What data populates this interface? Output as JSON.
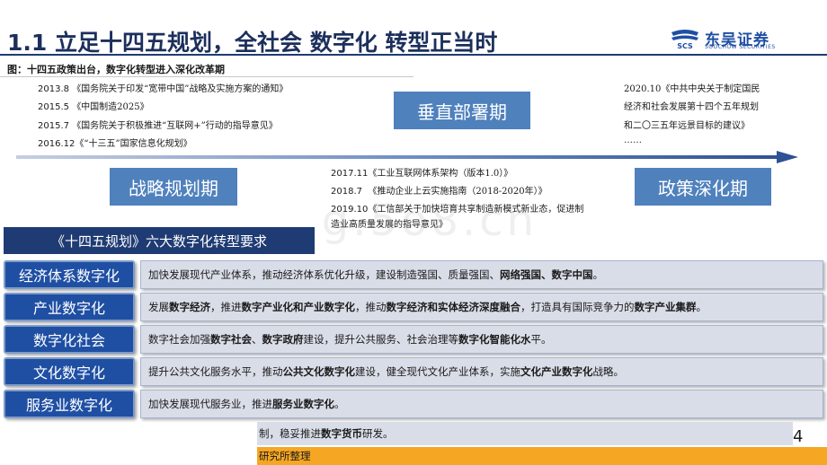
{
  "header": {
    "title": "1.1 立足十四五规划，全社会  数字化  转型正当时",
    "logo_cn": "东吴证券",
    "logo_en": "SOOCHOW SECURITIES",
    "logo_mark": "SCS"
  },
  "figure_caption": "图：十四五政策出台，数字化转型进入深化改革期",
  "timeline": {
    "upper_left": [
      {
        "year": "2013.8",
        "text": "《国务院关于印发“宽带中国”战略及实施方案的通知》"
      },
      {
        "year": "2015.5",
        "text": "《中国制造2025》"
      },
      {
        "year": "2015.7",
        "text": "《国务院关于积极推进“互联网+”行动的指导意见》"
      },
      {
        "year": "2016.12",
        "text": "《“十三五”国家信息化规划》"
      }
    ],
    "upper_right": [
      {
        "line": "2020.10《中共中央关于制定国民"
      },
      {
        "line": "经济和社会发展第十四个五年规划"
      },
      {
        "line": "和二〇三五年远景目标的建议》"
      },
      {
        "line": "……"
      }
    ],
    "lower_middle": [
      {
        "year": "2017.11",
        "text": "《工业互联网体系架构（版本1.0）》"
      },
      {
        "year": "2018.7",
        "text": "《推动企业上云实施指南（2018-2020年）》"
      },
      {
        "year": "2019.10",
        "text": "《工信部关于加快培育共享制造新模式新业态，促进制"
      },
      {
        "year": "",
        "text": "造业高质量发展的指导意见》"
      }
    ],
    "stages": {
      "vertical": "垂直部署期",
      "strategy": "战略规划期",
      "deepening": "政策深化期"
    }
  },
  "requirements": {
    "title": "《十四五规划》六大数字化转型要求",
    "rows": [
      {
        "label": "经济体系数字化",
        "segments": [
          {
            "t": "加快发展现代产业体系，推动经济体系优化升级，建设制造强国、质量强国、",
            "b": false
          },
          {
            "t": "网络强国、数字中国",
            "b": true
          },
          {
            "t": "。",
            "b": false
          }
        ]
      },
      {
        "label": "产业数字化",
        "segments": [
          {
            "t": "发展",
            "b": false
          },
          {
            "t": "数字经济",
            "b": true
          },
          {
            "t": "，推进",
            "b": false
          },
          {
            "t": "数字产业化和产业数字化",
            "b": true
          },
          {
            "t": "，推动",
            "b": false
          },
          {
            "t": "数字经济和实体经济深度融合",
            "b": true
          },
          {
            "t": "，打造具有国际竞争力的",
            "b": false
          },
          {
            "t": "数字产业集群",
            "b": true
          },
          {
            "t": "。",
            "b": false
          }
        ]
      },
      {
        "label": "数字化社会",
        "segments": [
          {
            "t": "数字社会加强",
            "b": false
          },
          {
            "t": "数字社会",
            "b": true
          },
          {
            "t": "、",
            "b": false
          },
          {
            "t": "数字政府",
            "b": true
          },
          {
            "t": "建设，提升公共服务、社会治理等",
            "b": false
          },
          {
            "t": "数字化智能化水",
            "b": true
          },
          {
            "t": "平。",
            "b": false
          }
        ]
      },
      {
        "label": "文化数字化",
        "segments": [
          {
            "t": "提升公共文化服务水平，推动",
            "b": false
          },
          {
            "t": "公共文化数字化",
            "b": true
          },
          {
            "t": "建设，健全现代文化产业体系，实施",
            "b": false
          },
          {
            "t": "文化产业数字化",
            "b": true
          },
          {
            "t": "战略。",
            "b": false
          }
        ]
      },
      {
        "label": "服务业数字化",
        "segments": [
          {
            "t": "加快发展现代服务业，推进",
            "b": false
          },
          {
            "t": "服务业数字化",
            "b": true
          },
          {
            "t": "。",
            "b": false
          }
        ]
      }
    ],
    "fragment": [
      {
        "t": "制，稳妥推进",
        "b": false
      },
      {
        "t": "数字货币",
        "b": true
      },
      {
        "t": "研发。",
        "b": false
      }
    ]
  },
  "page_number": "4",
  "source": "研究所整理",
  "watermark": "...g.5o8.cn",
  "colors": {
    "navy": "#1f3b73",
    "stage_blue": "#4f81bd",
    "label_blue": "#1f4fa3",
    "desc_bg": "#d9dde8",
    "source_bg": "#f5a623"
  }
}
